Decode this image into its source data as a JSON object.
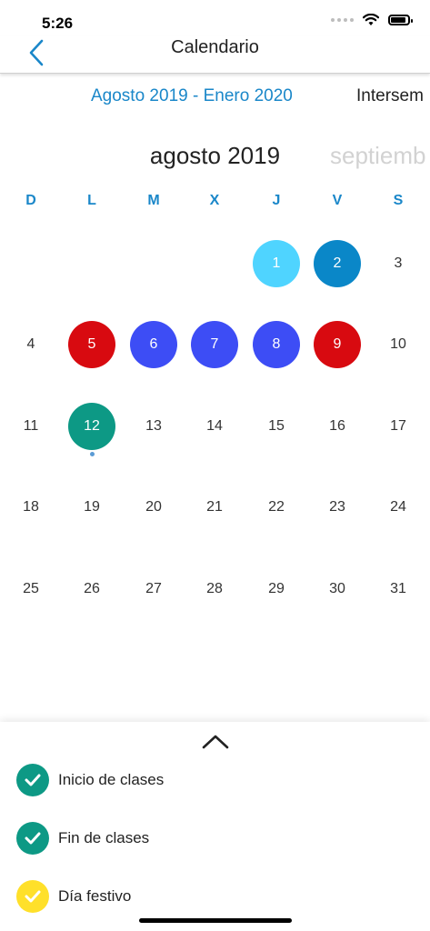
{
  "status_bar": {
    "time": "5:26"
  },
  "nav": {
    "title": "Calendario",
    "back_icon": "chevron-left-icon"
  },
  "period_tabs": [
    {
      "label": "Agosto 2019 -  Enero 2020",
      "active": true
    },
    {
      "label": "Intersem",
      "active": false
    }
  ],
  "month": {
    "current": "agosto 2019",
    "next": "septiemb"
  },
  "weekdays": [
    "D",
    "L",
    "M",
    "X",
    "J",
    "V",
    "S"
  ],
  "days": [
    {
      "day": "1",
      "color": "#4fd4ff"
    },
    {
      "day": "2",
      "color": "#0a87c8"
    },
    {
      "day": "3",
      "color": ""
    },
    {
      "day": "4",
      "color": ""
    },
    {
      "day": "5",
      "color": "#d80a10"
    },
    {
      "day": "6",
      "color": "#3d4df5"
    },
    {
      "day": "7",
      "color": "#3d4df5"
    },
    {
      "day": "8",
      "color": "#3d4df5"
    },
    {
      "day": "9",
      "color": "#d80a10"
    },
    {
      "day": "10",
      "color": ""
    },
    {
      "day": "11",
      "color": ""
    },
    {
      "day": "12",
      "color": "#0d9985",
      "today": true
    },
    {
      "day": "13",
      "color": ""
    },
    {
      "day": "14",
      "color": ""
    },
    {
      "day": "15",
      "color": ""
    },
    {
      "day": "16",
      "color": ""
    },
    {
      "day": "17",
      "color": ""
    },
    {
      "day": "18",
      "color": ""
    },
    {
      "day": "19",
      "color": ""
    },
    {
      "day": "20",
      "color": ""
    },
    {
      "day": "21",
      "color": ""
    },
    {
      "day": "22",
      "color": ""
    },
    {
      "day": "23",
      "color": ""
    },
    {
      "day": "24",
      "color": ""
    },
    {
      "day": "25",
      "color": ""
    },
    {
      "day": "26",
      "color": ""
    },
    {
      "day": "27",
      "color": ""
    },
    {
      "day": "28",
      "color": ""
    },
    {
      "day": "29",
      "color": ""
    },
    {
      "day": "30",
      "color": ""
    },
    {
      "day": "31",
      "color": ""
    }
  ],
  "first_weekday_index": 4,
  "legend": [
    {
      "label": "Inicio de clases",
      "color": "#0d9985",
      "icon": "check-icon"
    },
    {
      "label": "Fin de clases",
      "color": "#0d9985",
      "icon": "check-icon"
    },
    {
      "label": "Día festivo",
      "color": "#ffe02a",
      "icon": "check-icon"
    }
  ],
  "colors": {
    "accent": "#1a87c9",
    "text": "#222222",
    "inactive_month": "#d2d2d2"
  },
  "sheet": {
    "toggle_icon": "chevron-up-icon"
  }
}
